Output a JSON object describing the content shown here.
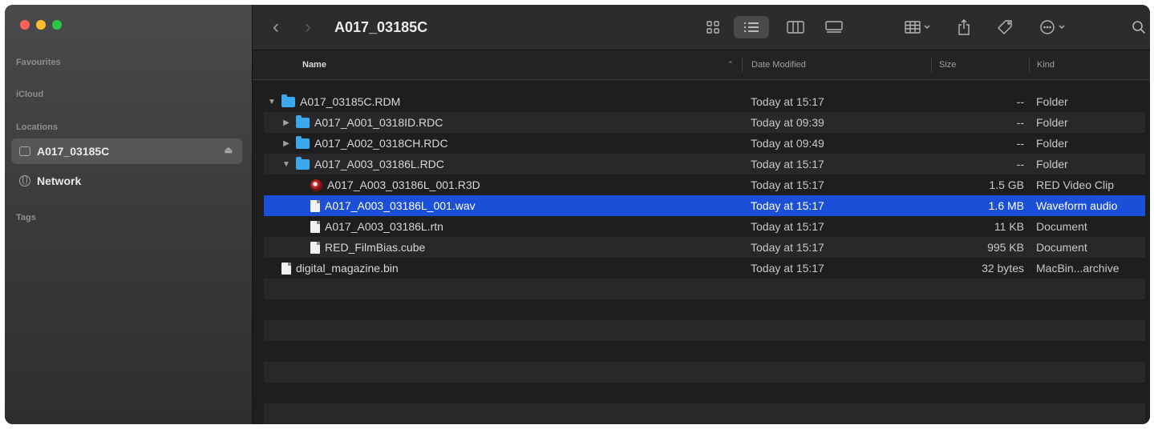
{
  "window": {
    "title": "A017_03185C"
  },
  "sidebar": {
    "sections": {
      "favourites": "Favourites",
      "icloud": "iCloud",
      "locations": "Locations",
      "tags": "Tags"
    },
    "items": [
      {
        "label": "A017_03185C",
        "icon": "drive-icon",
        "selected": true
      },
      {
        "label": "Network",
        "icon": "globe-icon",
        "selected": false
      }
    ]
  },
  "toolbar": {
    "back": "‹",
    "forward": "›",
    "icons": [
      "icon-view",
      "list-view",
      "column-view",
      "gallery-view",
      "group-by",
      "share",
      "tags",
      "more-actions",
      "search"
    ]
  },
  "columns": {
    "name": "Name",
    "date": "Date Modified",
    "size": "Size",
    "kind": "Kind"
  },
  "rows": [
    {
      "name": "A017_03185C.RDM",
      "date": "Today at 15:17",
      "size": "--",
      "kind": "Folder",
      "type": "folder",
      "expanded": true,
      "level": 0
    },
    {
      "name": "A017_A001_0318ID.RDC",
      "date": "Today at 09:39",
      "size": "--",
      "kind": "Folder",
      "type": "folder",
      "expanded": false,
      "level": 1
    },
    {
      "name": "A017_A002_0318CH.RDC",
      "date": "Today at 09:49",
      "size": "--",
      "kind": "Folder",
      "type": "folder",
      "expanded": false,
      "level": 1
    },
    {
      "name": "A017_A003_03186L.RDC",
      "date": "Today at 15:17",
      "size": "--",
      "kind": "Folder",
      "type": "folder",
      "expanded": true,
      "level": 1
    },
    {
      "name": "A017_A003_03186L_001.R3D",
      "date": "Today at 15:17",
      "size": "1.5 GB",
      "kind": "RED Video Clip",
      "type": "r3d",
      "level": 2
    },
    {
      "name": "A017_A003_03186L_001.wav",
      "date": "Today at 15:17",
      "size": "1.6 MB",
      "kind": "Waveform audio",
      "type": "doc",
      "level": 2,
      "selected": true
    },
    {
      "name": "A017_A003_03186L.rtn",
      "date": "Today at 15:17",
      "size": "11 KB",
      "kind": "Document",
      "type": "doc",
      "level": 2
    },
    {
      "name": "RED_FilmBias.cube",
      "date": "Today at 15:17",
      "size": "995 KB",
      "kind": "Document",
      "type": "doc",
      "level": 2
    },
    {
      "name": "digital_magazine.bin",
      "date": "Today at 15:17",
      "size": "32 bytes",
      "kind": "MacBin...archive",
      "type": "doc",
      "level": 0
    }
  ],
  "colors": {
    "selection": "#1c4fd8",
    "folder": "#3aa8ee"
  }
}
